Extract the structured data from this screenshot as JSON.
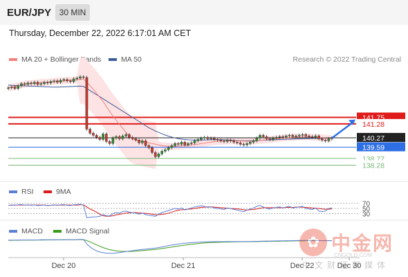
{
  "header": {
    "symbol": "EUR/JPY",
    "timeframe": "30 MIN"
  },
  "datetime": "Thursday, December 22, 2022 6:17:01 AM CET",
  "legend": {
    "ma20": "MA 20 + Bollinger Bands",
    "ma50": "MA 50",
    "ma20_color": "#f08080",
    "ma50_color": "#3d5a99"
  },
  "credit": "Research © 2022 Trading Central",
  "chart_data": [
    {
      "type": "candlestick",
      "ylim": [
        137.3,
        145.5
      ],
      "close": [
        143.9,
        143.95,
        143.85,
        144.05,
        144.2,
        144.15,
        144.25,
        144.2,
        144.3,
        144.15,
        144.2,
        144.3,
        144.25,
        144.35,
        144.4,
        144.3,
        144.45,
        144.5,
        144.4,
        144.35,
        144.55,
        144.6,
        144.7,
        144.65,
        140.9,
        140.6,
        140.45,
        140.3,
        140.15,
        140.55,
        140.0,
        139.85,
        140.25,
        140.35,
        140.2,
        140.4,
        140.5,
        140.3,
        140.2,
        140.1,
        139.9,
        140.05,
        139.7,
        139.55,
        139.2,
        138.9,
        139.1,
        139.3,
        139.4,
        139.55,
        139.7,
        139.85,
        139.8,
        139.95,
        139.75,
        139.85,
        139.9,
        140.05,
        140.15,
        140.25,
        140.3,
        140.2,
        140.25,
        140.15,
        140.1,
        140.05,
        140.0,
        140.1,
        140.05,
        139.95,
        139.9,
        139.8,
        139.75,
        139.85,
        139.95,
        140.05,
        140.25,
        140.45,
        140.35,
        140.2,
        140.15,
        140.25,
        140.3,
        140.35,
        140.3,
        140.4,
        140.45,
        140.35,
        140.4,
        140.45,
        140.5,
        140.4,
        140.35,
        140.3,
        140.4,
        140.2,
        140.1,
        140.05,
        140.2,
        140.25
      ],
      "ma20": [
        143.9,
        143.95,
        144.0,
        144.05,
        144.1,
        144.15,
        144.2,
        144.2,
        144.25,
        144.25,
        144.3,
        144.3,
        144.3,
        144.35,
        144.35,
        144.4,
        144.4,
        144.4,
        144.45,
        144.45,
        144.45,
        144.5,
        144.5,
        144.55,
        144.3,
        144.05,
        143.8,
        143.5,
        143.2,
        142.9,
        142.55,
        142.2,
        141.85,
        141.55,
        141.25,
        140.95,
        140.65,
        140.4,
        140.2,
        140.1,
        140.05,
        140.0,
        139.95,
        139.9,
        139.85,
        139.8,
        139.75,
        139.7,
        139.68,
        139.66,
        139.65,
        139.65,
        139.66,
        139.68,
        139.7,
        139.72,
        139.75,
        139.78,
        139.8,
        139.85,
        139.88,
        139.92,
        139.95,
        139.98,
        140.0,
        140.02,
        140.03,
        140.04,
        140.05,
        140.05,
        140.05,
        140.04,
        140.03,
        140.02,
        140.02,
        140.03,
        140.05,
        140.08,
        140.1,
        140.12,
        140.15,
        140.18,
        140.2,
        140.22,
        140.25,
        140.27,
        140.29,
        140.3,
        140.32,
        140.33,
        140.34,
        140.34,
        140.33,
        140.32,
        140.31,
        140.29,
        140.27,
        140.24,
        140.22,
        140.22
      ],
      "ma50": [
        144.1,
        144.08,
        144.07,
        144.06,
        144.05,
        144.04,
        144.03,
        144.02,
        144.01,
        144.0,
        143.99,
        143.98,
        143.97,
        143.96,
        143.95,
        143.95,
        143.96,
        143.97,
        143.98,
        143.99,
        144.0,
        144.01,
        144.02,
        144.0,
        143.85,
        143.7,
        143.55,
        143.4,
        143.25,
        143.1,
        142.95,
        142.8,
        142.65,
        142.5,
        142.35,
        142.2,
        142.05,
        141.9,
        141.75,
        141.6,
        141.45,
        141.3,
        141.15,
        141.0,
        140.88,
        140.76,
        140.66,
        140.56,
        140.47,
        140.39,
        140.32,
        140.26,
        140.21,
        140.17,
        140.14,
        140.12,
        140.11,
        140.1,
        140.1,
        140.1,
        140.11,
        140.12,
        140.13,
        140.13,
        140.13,
        140.13,
        140.12,
        140.11,
        140.1,
        140.08,
        140.07,
        140.06,
        140.05,
        140.05,
        140.05,
        140.06,
        140.07,
        140.08,
        140.09,
        140.1,
        140.11,
        140.12,
        140.13,
        140.14,
        140.15,
        140.16,
        140.17,
        140.18,
        140.19,
        140.2,
        140.21,
        140.22,
        140.22,
        140.23,
        140.23,
        140.23,
        140.23,
        140.23,
        140.24,
        140.24
      ],
      "levels": [
        {
          "value": 141.75,
          "label": "141.75",
          "color": "#e01b1b"
        },
        {
          "value": 141.28,
          "label": "141.28",
          "color": "#e01b1b"
        },
        {
          "value": 140.27,
          "label": "140.27",
          "color": "#222222"
        },
        {
          "value": 139.59,
          "label": "139.59",
          "color": "#2f6fe6"
        },
        {
          "value": 138.77,
          "label": "138.77",
          "color": "#7ab87a"
        },
        {
          "value": 138.28,
          "label": "138.28",
          "color": "#7ab87a"
        }
      ],
      "xlabels": [
        "Dec 20",
        "Dec 21",
        "Dec 22",
        "Dec 30"
      ]
    },
    {
      "type": "line",
      "series": [
        {
          "name": "RSI",
          "color": "#5b7fd6"
        },
        {
          "name": "9MA",
          "color": "#d81b1b"
        }
      ],
      "ylim": [
        10,
        90
      ],
      "levels": [
        "70",
        "50",
        "30"
      ],
      "rsi": [
        62,
        63,
        62,
        64,
        65,
        63,
        64,
        62,
        64,
        61,
        62,
        63,
        61,
        62,
        64,
        62,
        64,
        65,
        62,
        61,
        64,
        65,
        66,
        63,
        14,
        16,
        17,
        18,
        20,
        26,
        22,
        21,
        30,
        34,
        32,
        38,
        40,
        36,
        34,
        32,
        28,
        33,
        26,
        24,
        22,
        20,
        28,
        34,
        38,
        42,
        46,
        50,
        48,
        52,
        44,
        48,
        52,
        56,
        58,
        60,
        58,
        54,
        56,
        52,
        50,
        48,
        46,
        52,
        50,
        46,
        44,
        40,
        38,
        44,
        48,
        52,
        58,
        62,
        56,
        50,
        48,
        52,
        54,
        56,
        52,
        56,
        58,
        52,
        54,
        56,
        58,
        50,
        48,
        46,
        52,
        40,
        38,
        40,
        50,
        52
      ],
      "ma9": [
        62,
        62,
        63,
        63,
        63,
        63,
        63,
        63,
        63,
        63,
        63,
        63,
        62,
        62,
        63,
        63,
        63,
        63,
        63,
        63,
        63,
        63,
        64,
        64,
        56,
        48,
        42,
        36,
        28,
        22,
        20,
        20,
        22,
        25,
        27,
        30,
        32,
        33,
        34,
        34,
        33,
        32,
        31,
        30,
        28,
        26,
        26,
        27,
        29,
        32,
        36,
        40,
        43,
        45,
        46,
        47,
        48,
        50,
        52,
        54,
        55,
        56,
        56,
        55,
        54,
        53,
        52,
        51,
        50,
        49,
        48,
        47,
        45,
        44,
        45,
        46,
        48,
        51,
        53,
        53,
        53,
        53,
        53,
        53,
        53,
        54,
        54,
        54,
        55,
        55,
        55,
        54,
        53,
        52,
        51,
        50,
        48,
        47,
        47,
        48
      ]
    },
    {
      "type": "line",
      "series": [
        {
          "name": "MACD",
          "color": "#5b7fd6"
        },
        {
          "name": "MACD Signal",
          "color": "#3a9a1a"
        }
      ],
      "ylim": [
        -1.6,
        0.6
      ],
      "macd": [
        0.22,
        0.23,
        0.23,
        0.24,
        0.24,
        0.24,
        0.25,
        0.25,
        0.25,
        0.25,
        0.26,
        0.26,
        0.26,
        0.26,
        0.27,
        0.27,
        0.27,
        0.28,
        0.28,
        0.28,
        0.28,
        0.29,
        0.3,
        0.3,
        -0.2,
        -0.55,
        -0.8,
        -1.0,
        -1.12,
        -1.2,
        -1.25,
        -1.27,
        -1.26,
        -1.22,
        -1.18,
        -1.13,
        -1.07,
        -1.02,
        -0.97,
        -0.92,
        -0.88,
        -0.84,
        -0.8,
        -0.76,
        -0.72,
        -0.68,
        -0.62,
        -0.55,
        -0.48,
        -0.4,
        -0.33,
        -0.27,
        -0.22,
        -0.17,
        -0.13,
        -0.09,
        -0.06,
        -0.03,
        -0.01,
        0.01,
        0.03,
        0.04,
        0.05,
        0.05,
        0.05,
        0.05,
        0.05,
        0.06,
        0.06,
        0.06,
        0.06,
        0.06,
        0.06,
        0.07,
        0.07,
        0.08,
        0.09,
        0.1,
        0.11,
        0.12,
        0.12,
        0.13,
        0.14,
        0.15,
        0.15,
        0.16,
        0.16,
        0.17,
        0.17,
        0.18,
        0.18,
        0.18,
        0.18,
        0.18,
        0.18,
        0.17,
        0.17,
        0.16,
        0.16,
        0.16
      ],
      "signal": [
        0.2,
        0.2,
        0.21,
        0.21,
        0.22,
        0.22,
        0.22,
        0.23,
        0.23,
        0.24,
        0.24,
        0.24,
        0.25,
        0.25,
        0.25,
        0.26,
        0.26,
        0.26,
        0.27,
        0.27,
        0.27,
        0.28,
        0.28,
        0.28,
        0.18,
        0.03,
        -0.14,
        -0.31,
        -0.47,
        -0.62,
        -0.74,
        -0.85,
        -0.93,
        -0.99,
        -1.03,
        -1.05,
        -1.06,
        -1.06,
        -1.04,
        -1.02,
        -0.99,
        -0.96,
        -0.93,
        -0.89,
        -0.86,
        -0.82,
        -0.78,
        -0.73,
        -0.68,
        -0.62,
        -0.56,
        -0.5,
        -0.44,
        -0.39,
        -0.34,
        -0.29,
        -0.24,
        -0.2,
        -0.16,
        -0.13,
        -0.1,
        -0.07,
        -0.05,
        -0.03,
        -0.02,
        -0.01,
        0.0,
        0.01,
        0.02,
        0.03,
        0.03,
        0.04,
        0.04,
        0.05,
        0.05,
        0.06,
        0.06,
        0.07,
        0.08,
        0.08,
        0.09,
        0.1,
        0.1,
        0.11,
        0.12,
        0.12,
        0.13,
        0.14,
        0.14,
        0.15,
        0.15,
        0.16,
        0.16,
        0.16,
        0.17,
        0.17,
        0.17,
        0.17,
        0.17,
        0.17
      ]
    }
  ],
  "watermark": {
    "mark": "中金网",
    "url": "CNGOLD.COM",
    "sub": "中文财经新媒体"
  }
}
